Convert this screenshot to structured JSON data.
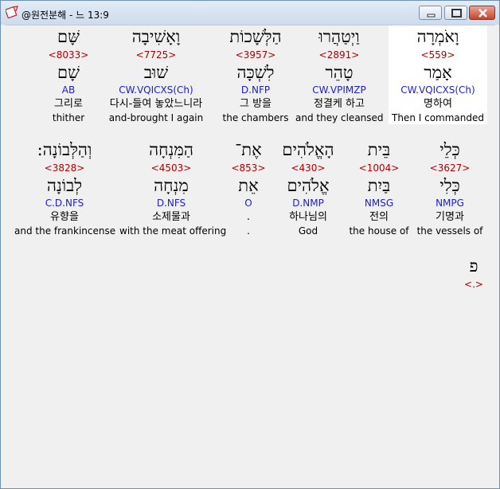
{
  "window": {
    "title": "@원전분해 - 느 13:9",
    "buttons": {
      "minimize": "minimize",
      "maximize": "maximize",
      "close": "close"
    }
  },
  "rows": [
    {
      "words": [
        {
          "hebrew": "וָאֹמְרָה",
          "strong": "<559>",
          "lemma": "אָמַר",
          "parse": "CW.VQICXS(Ch)",
          "korean": "명하여",
          "english": "Then I commanded",
          "selected": true
        },
        {
          "hebrew": "וַיְטַהֲרוּ",
          "strong": "<2891>",
          "lemma": "טָהֵר",
          "parse": "CW.VPIMZP",
          "korean": "정결케 하고",
          "english": "and they cleansed"
        },
        {
          "hebrew": "הַלְּשָׁכוֹת",
          "strong": "<3957>",
          "lemma": "לִשְׁכָּה",
          "parse": "D.NFP",
          "korean": "그 방을",
          "english": "the chambers"
        },
        {
          "hebrew": "וָאָשִׁיבָה",
          "strong": "<7725>",
          "lemma": "שׁוּב",
          "parse": "CW.VQICXS(Ch)",
          "korean": "다시-들여 놓았느니라",
          "english": "and-brought I again"
        },
        {
          "hebrew": "שָּׁם",
          "strong": "<8033>",
          "lemma": "שָׁם",
          "parse": "AB",
          "korean": "그리로",
          "english": "thither"
        }
      ]
    },
    {
      "words": [
        {
          "hebrew": "כְּלֵי",
          "strong": "<3627>",
          "lemma": "כְּלִי",
          "parse": "NMPG",
          "korean": "기명과",
          "english": "the vessels of"
        },
        {
          "hebrew": "בֵּית",
          "strong": "<1004>",
          "lemma": "בַּיִת",
          "parse": "NMSG",
          "korean": "전의",
          "english": "the house of"
        },
        {
          "hebrew": "הָאֱלֹהִים",
          "strong": "<430>",
          "lemma": "אֱלֹהִים",
          "parse": "D.NMP",
          "korean": "하나님의",
          "english": "God"
        },
        {
          "hebrew": "אֶת־",
          "strong": "<853>",
          "lemma": "אֵת",
          "parse": "O",
          "korean": ".",
          "english": "."
        },
        {
          "hebrew": "הַמִּנְחָה",
          "strong": "<4503>",
          "lemma": "מִנְחָה",
          "parse": "D.NFS",
          "korean": "소제물과",
          "english": "with the meat offering"
        },
        {
          "hebrew": "וְהַלְּבוֹנָה:",
          "strong": "<3828>",
          "lemma": "לְבוֹנָה",
          "parse": "C.D.NFS",
          "korean": "유향을",
          "english": "and the frankincense"
        }
      ]
    },
    {
      "words": [
        {
          "hebrew": "פ",
          "strong": "<.>"
        }
      ]
    }
  ]
}
